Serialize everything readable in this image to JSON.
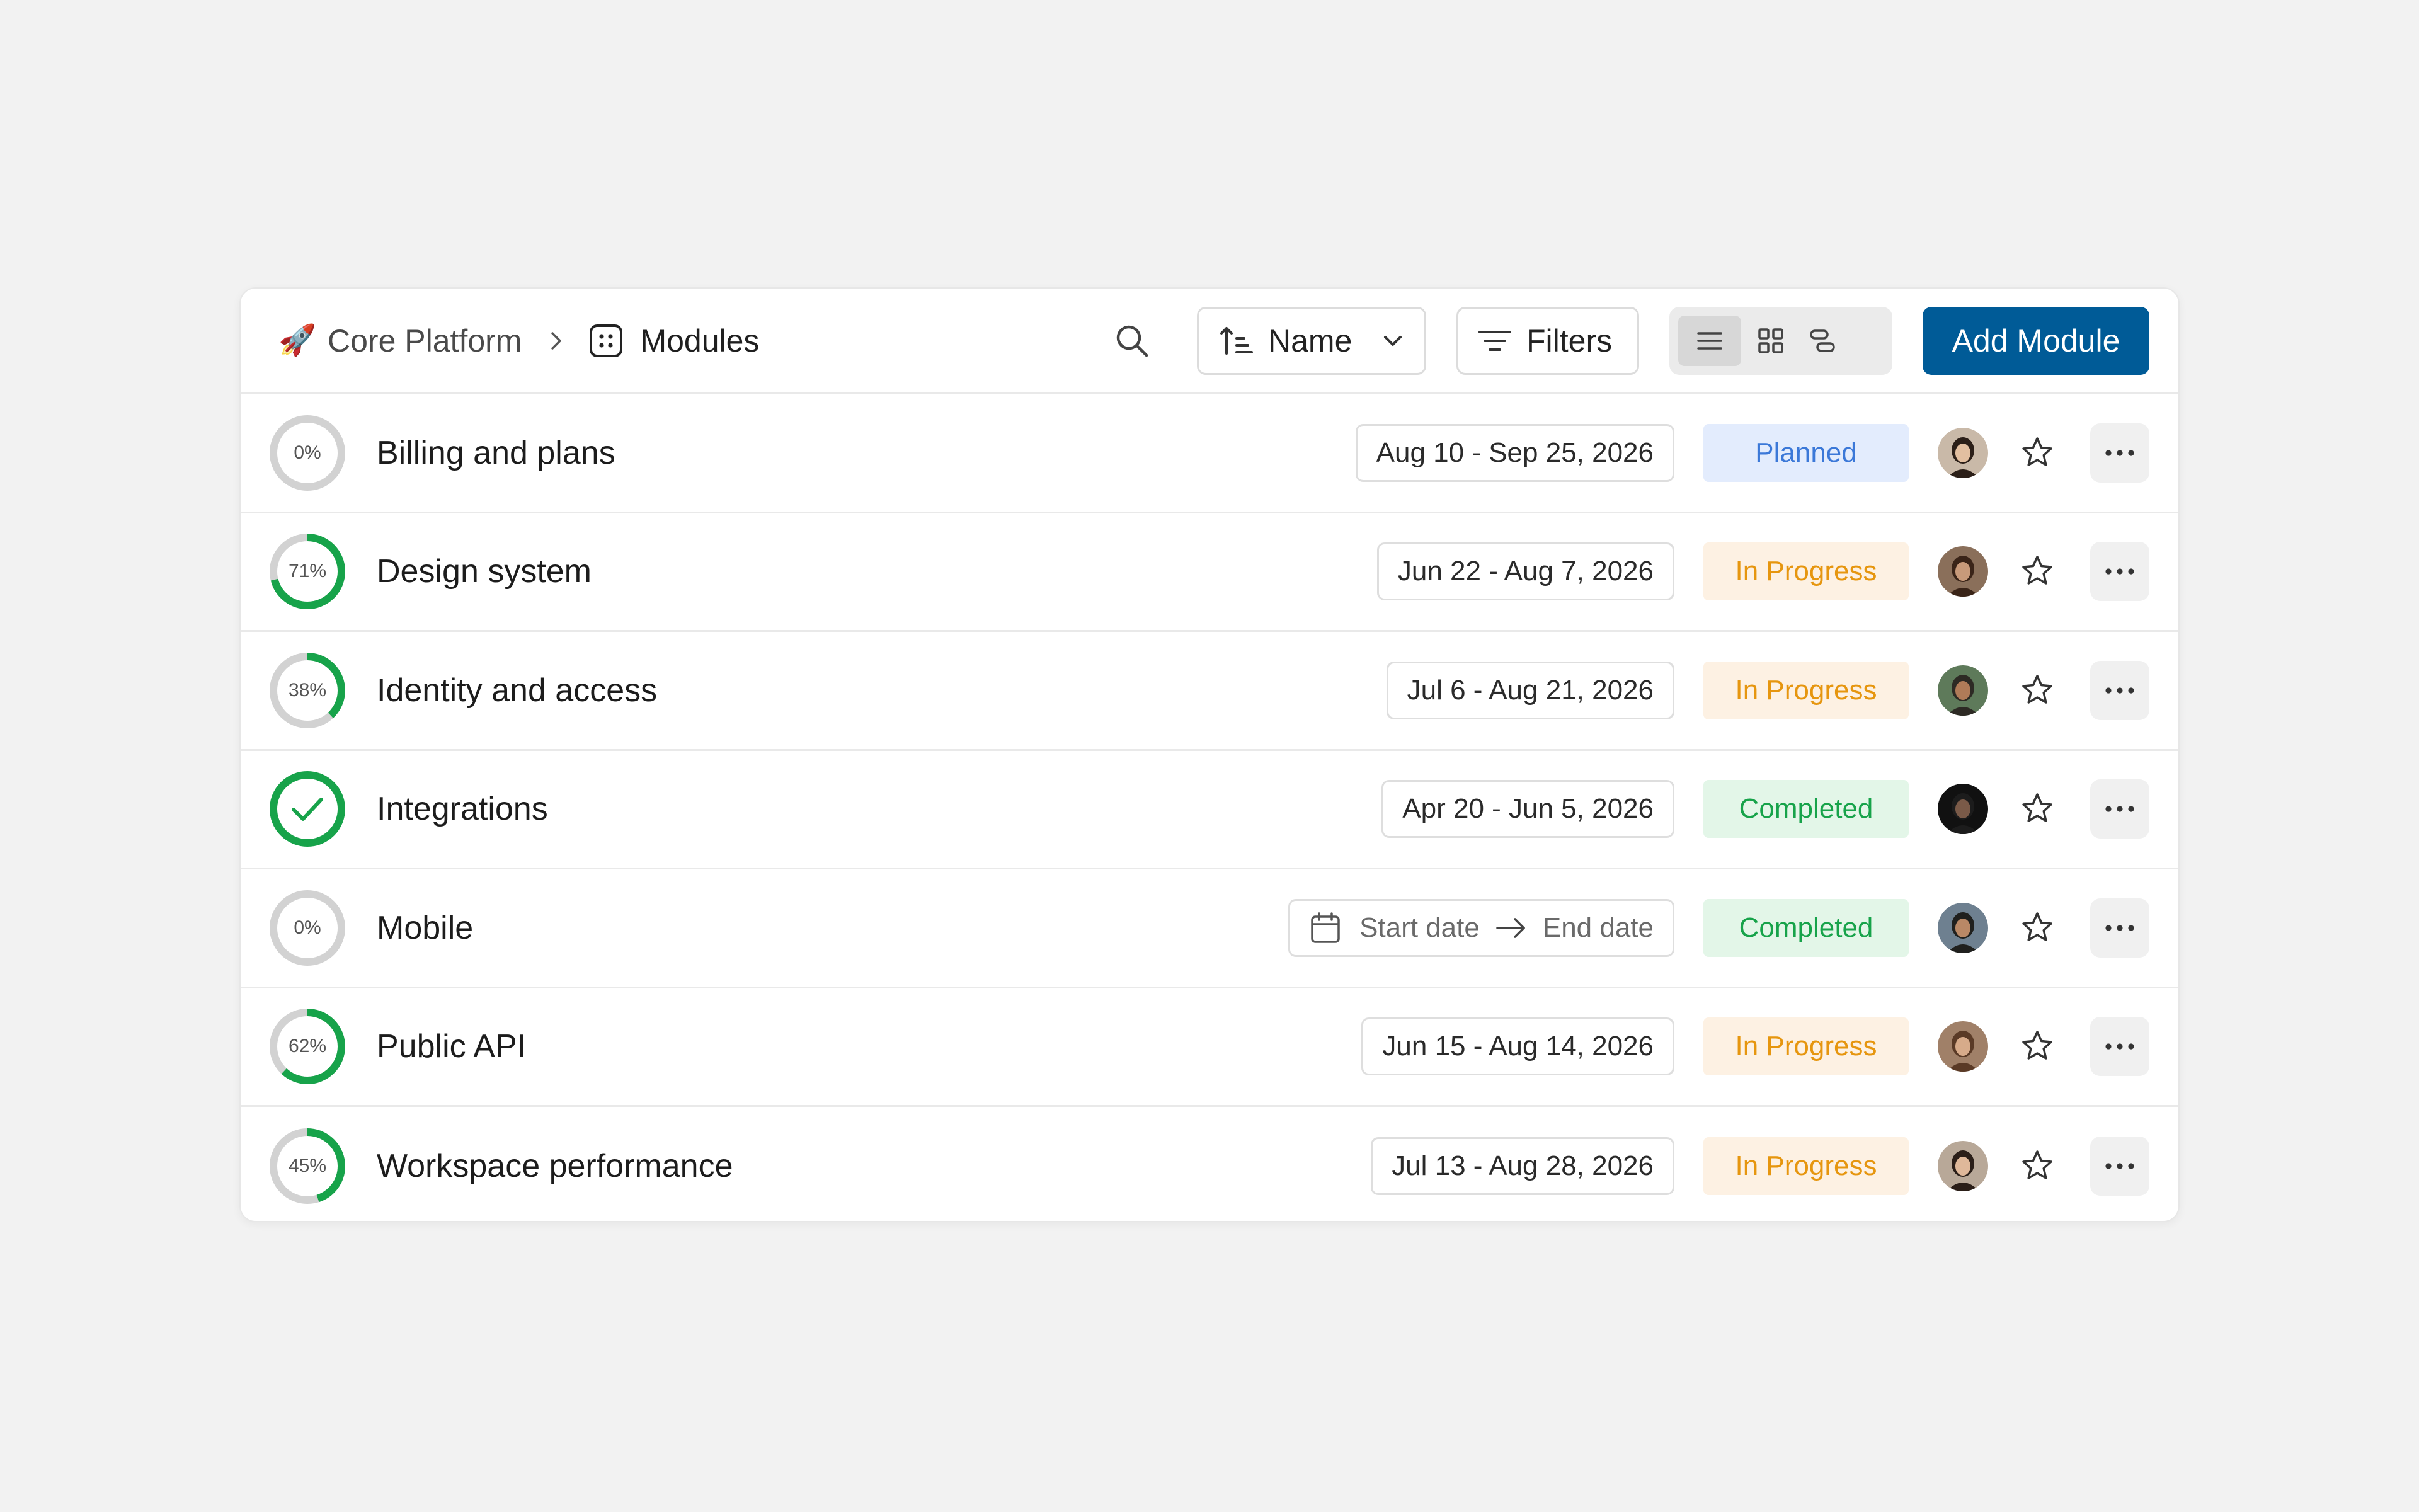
{
  "breadcrumb": {
    "project_icon": "rocket-emoji",
    "project_emoji": "🚀",
    "project": "Core Platform",
    "page_icon": "modules-icon",
    "page": "Modules"
  },
  "toolbar": {
    "sort_label": "Name",
    "filters_label": "Filters",
    "view_modes": [
      "list",
      "gallery",
      "timeline"
    ],
    "active_view": "list",
    "add_label": "Add Module"
  },
  "colors": {
    "accent": "#005b97",
    "progress_green": "#17a34a",
    "ring_track": "#d2d2d2",
    "planned": "#3b78d8",
    "in_progress": "#e6960f",
    "completed": "#17a34a"
  },
  "modules": [
    {
      "name": "Billing and plans",
      "progress": 0,
      "progress_label": "0%",
      "dates": "Aug 10 - Sep 25, 2026",
      "status": "Planned",
      "status_type": "planned"
    },
    {
      "name": "Design system",
      "progress": 71,
      "progress_label": "71%",
      "dates": "Jun 22 - Aug 7, 2026",
      "status": "In Progress",
      "status_type": "progress"
    },
    {
      "name": "Identity and access",
      "progress": 38,
      "progress_label": "38%",
      "dates": "Jul 6 - Aug 21, 2026",
      "status": "In Progress",
      "status_type": "progress"
    },
    {
      "name": "Integrations",
      "progress": 100,
      "progress_label": "",
      "dates": "Apr 20 - Jun 5, 2026",
      "status": "Completed",
      "status_type": "completed"
    },
    {
      "name": "Mobile",
      "progress": 0,
      "progress_label": "0%",
      "dates": null,
      "start_placeholder": "Start date",
      "end_placeholder": "End date",
      "status": "Completed",
      "status_type": "completed"
    },
    {
      "name": "Public API",
      "progress": 62,
      "progress_label": "62%",
      "dates": "Jun 15 - Aug 14, 2026",
      "status": "In Progress",
      "status_type": "progress"
    },
    {
      "name": "Workspace performance",
      "progress": 45,
      "progress_label": "45%",
      "dates": "Jul 13 - Aug 28, 2026",
      "status": "In Progress",
      "status_type": "progress"
    }
  ]
}
